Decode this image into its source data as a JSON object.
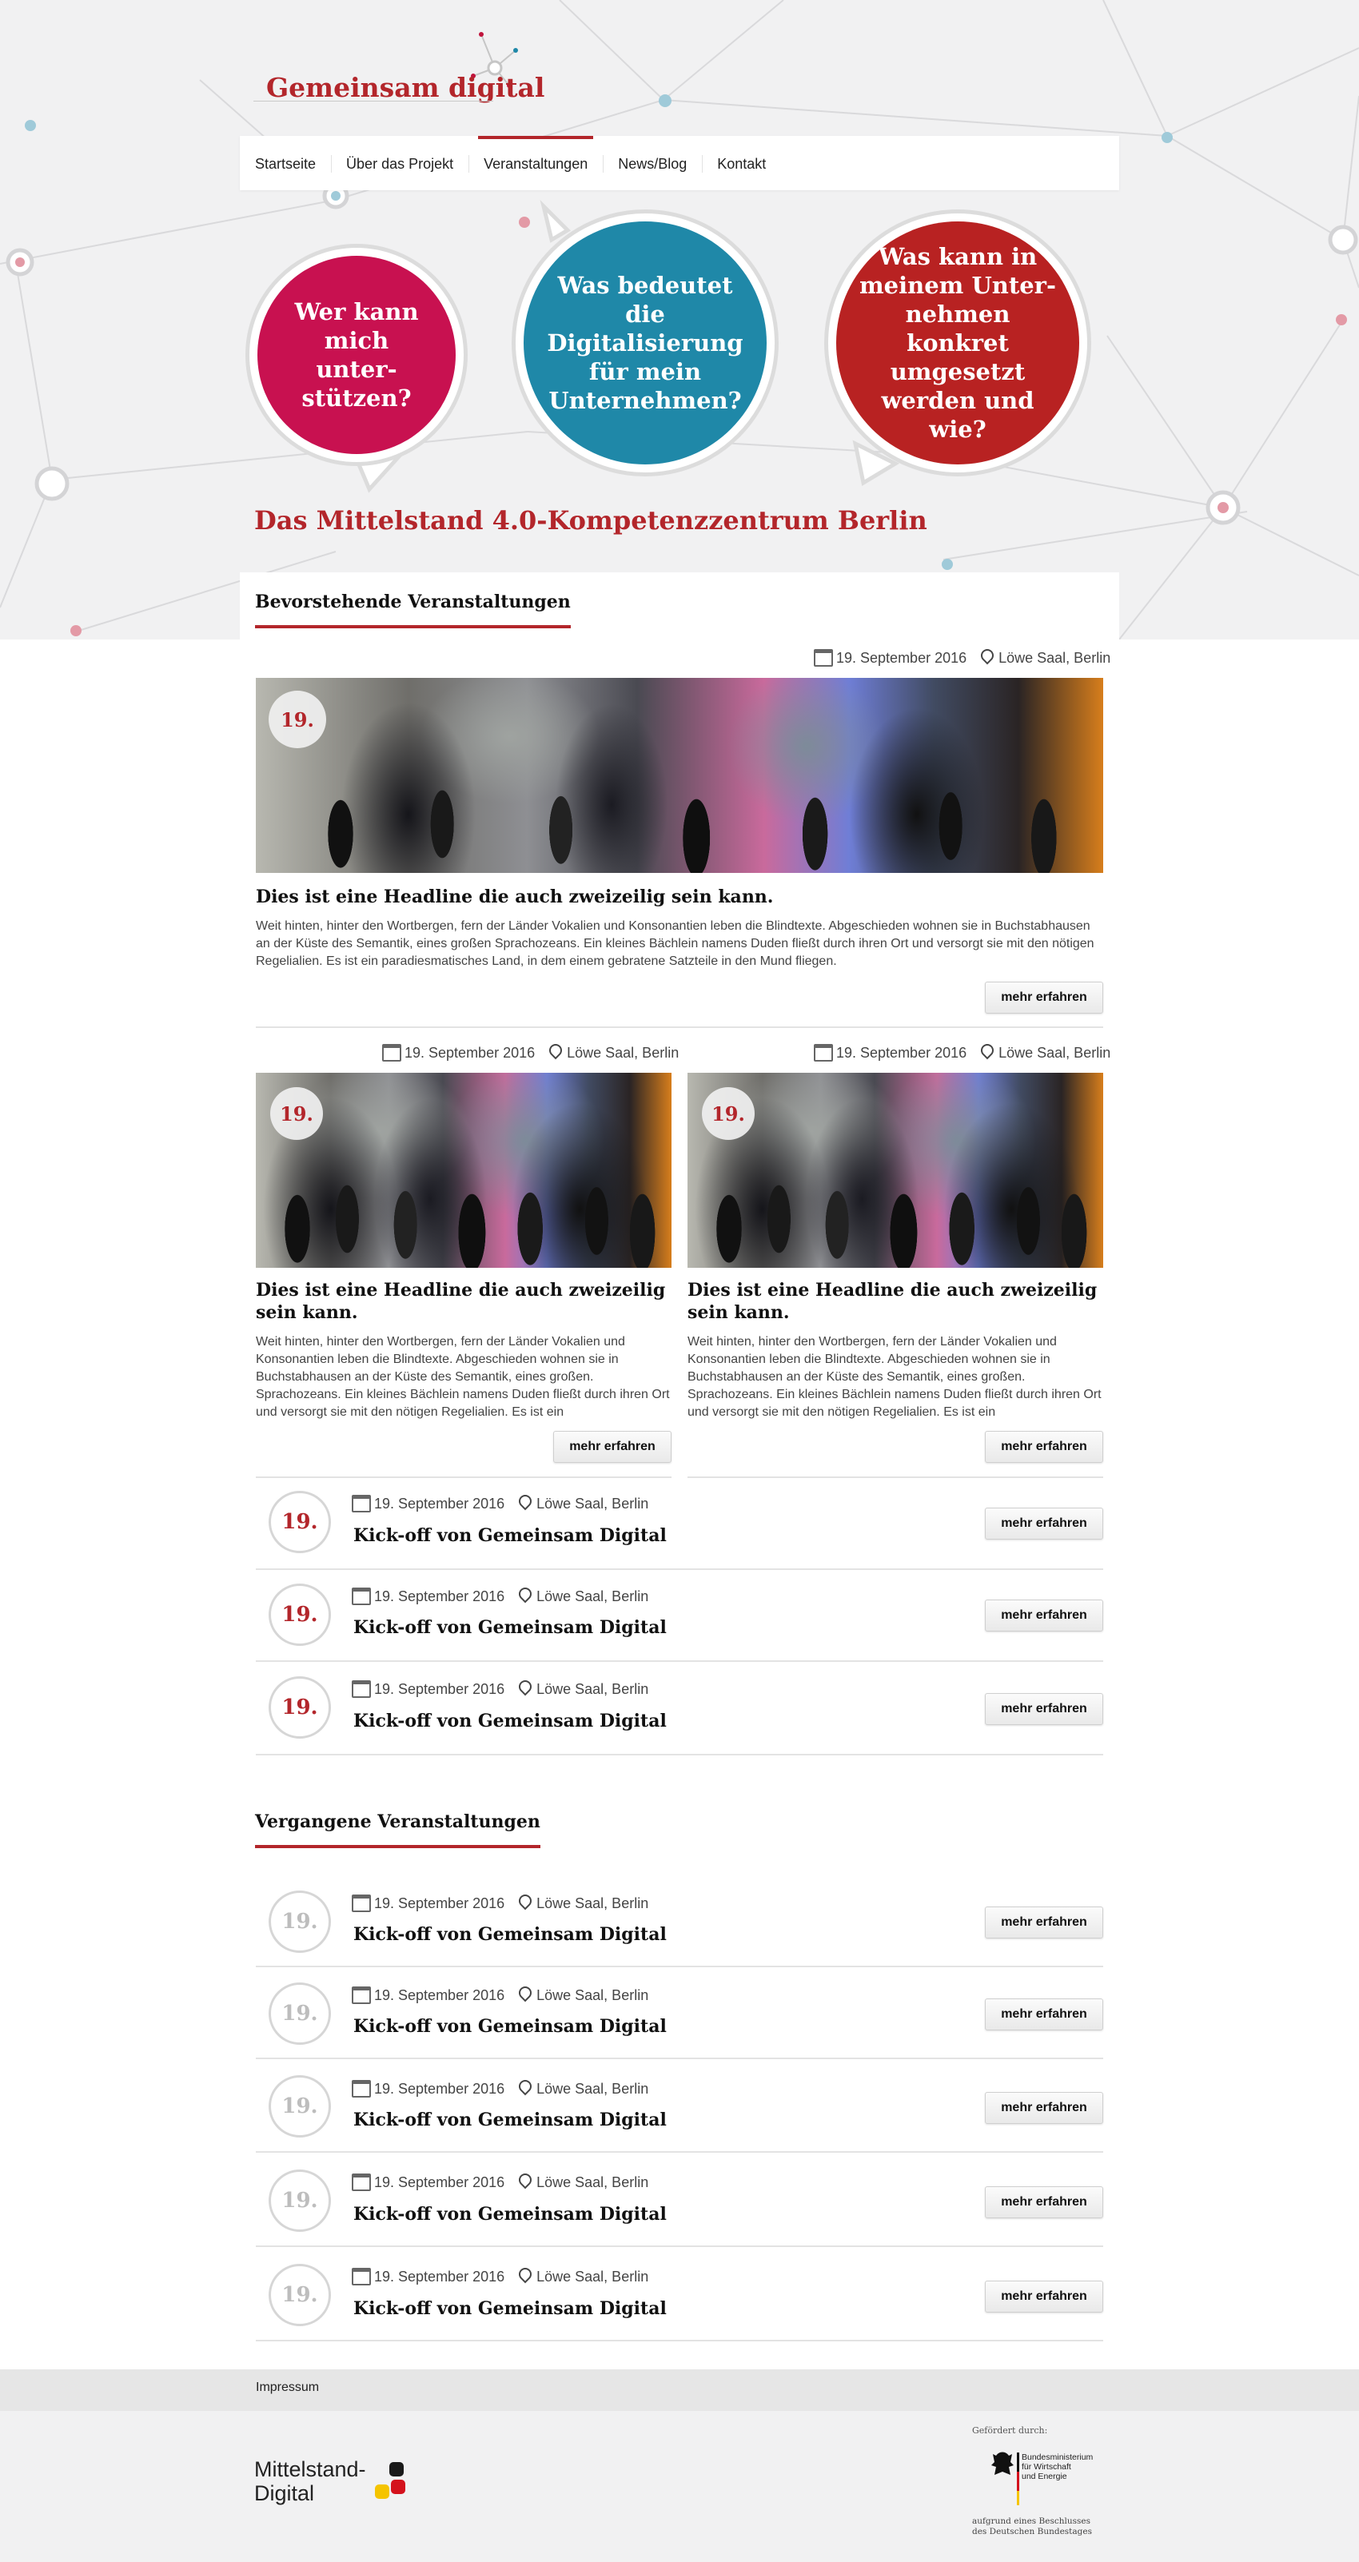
{
  "logo": {
    "text": "Gemeinsam digital"
  },
  "nav": {
    "items": [
      {
        "label": "Startseite"
      },
      {
        "label": "Über das Projekt"
      },
      {
        "label": "Veranstaltungen"
      },
      {
        "label": "News/Blog"
      },
      {
        "label": "Kontakt"
      }
    ],
    "active": "Veranstaltungen"
  },
  "bubbles": [
    {
      "text": "Wer kann mich unter-stützen?",
      "color": "#c81150"
    },
    {
      "text": "Was bedeutet die Digitalisierung für mein Unternehmen?",
      "color": "#1f88a8"
    },
    {
      "text": "Was kann in meinem Unter-nehmen konkret umgesetzt werden und wie?",
      "color": "#b82222"
    }
  ],
  "main_heading": "Das Mittelstand 4.0-Kompetenzzentrum Berlin",
  "upcoming": {
    "title": "Bevorstehende Veranstaltungen",
    "featured": {
      "date": "19. September 2016",
      "location": "Löwe Saal, Berlin",
      "day": "19.",
      "headline": "Dies ist eine Headline die auch zweizeilig sein kann.",
      "text": "Weit hinten, hinter den Wortbergen, fern der Länder Vokalien und Konsonantien leben die Blindtexte. Abgeschieden wohnen sie in Buchstabhausen an der Küste des Semantik, eines großen Sprachozeans. Ein kleines Bächlein namens Duden fließt durch ihren Ort und versorgt sie mit den nötigen Regelialien. Es ist ein paradiesmatisches Land, in dem einem gebratene Satzteile in den Mund fliegen.",
      "button": "mehr erfahren"
    },
    "cards": [
      {
        "date": "19. September 2016",
        "location": "Löwe Saal, Berlin",
        "day": "19.",
        "headline": "Dies ist eine Headline die auch zweizeilig sein kann.",
        "text": "Weit hinten, hinter den Wortbergen, fern der Länder Vokalien und Konsonantien leben die Blindtexte. Abgeschieden wohnen sie in Buchstabhausen an der Küste des Semantik, eines großen. Sprachozeans. Ein kleines Bächlein namens Duden fließt durch ihren Ort und versorgt sie mit den nötigen Regelialien. Es ist ein",
        "button": "mehr erfahren"
      },
      {
        "date": "19. September 2016",
        "location": "Löwe Saal, Berlin",
        "day": "19.",
        "headline": "Dies ist eine Headline die auch zweizeilig sein kann.",
        "text": "Weit hinten, hinter den Wortbergen, fern der Länder Vokalien und Konsonantien leben die Blindtexte. Abgeschieden wohnen sie in Buchstabhausen an der Küste des Semantik, eines großen. Sprachozeans. Ein kleines Bächlein namens Duden fließt durch ihren Ort und versorgt sie mit den nötigen Regelialien. Es ist ein",
        "button": "mehr erfahren"
      }
    ],
    "rows": [
      {
        "day": "19.",
        "date": "19. September 2016",
        "location": "Löwe Saal, Berlin",
        "title": "Kick-off von Gemeinsam Digital",
        "button": "mehr erfahren"
      },
      {
        "day": "19.",
        "date": "19. September 2016",
        "location": "Löwe Saal, Berlin",
        "title": "Kick-off von Gemeinsam Digital",
        "button": "mehr erfahren"
      },
      {
        "day": "19.",
        "date": "19. September 2016",
        "location": "Löwe Saal, Berlin",
        "title": "Kick-off von Gemeinsam Digital",
        "button": "mehr erfahren"
      }
    ]
  },
  "past": {
    "title": "Vergangene Veranstaltungen",
    "rows": [
      {
        "day": "19.",
        "date": "19. September 2016",
        "location": "Löwe Saal, Berlin",
        "title": "Kick-off von Gemeinsam Digital",
        "button": "mehr erfahren"
      },
      {
        "day": "19.",
        "date": "19. September 2016",
        "location": "Löwe Saal, Berlin",
        "title": "Kick-off von Gemeinsam Digital",
        "button": "mehr erfahren"
      },
      {
        "day": "19.",
        "date": "19. September 2016",
        "location": "Löwe Saal, Berlin",
        "title": "Kick-off von Gemeinsam Digital",
        "button": "mehr erfahren"
      },
      {
        "day": "19.",
        "date": "19. September 2016",
        "location": "Löwe Saal, Berlin",
        "title": "Kick-off von Gemeinsam Digital",
        "button": "mehr erfahren"
      },
      {
        "day": "19.",
        "date": "19. September 2016",
        "location": "Löwe Saal, Berlin",
        "title": "Kick-off von Gemeinsam Digital",
        "button": "mehr erfahren"
      }
    ]
  },
  "footer": {
    "impressum": "Impressum",
    "md_logo_line1": "Mittelstand-",
    "md_logo_line2": "Digital",
    "funded_label": "Gefördert durch:",
    "ministry_line1": "Bundesministerium",
    "ministry_line2": "für Wirtschaft",
    "ministry_line3": "und Energie",
    "bundestag_line1": "aufgrund eines Beschlusses",
    "bundestag_line2": "des Deutschen Bundestages"
  },
  "colors": {
    "accent": "#b3262b",
    "magenta": "#c81150",
    "teal": "#1f88a8",
    "red": "#b82222"
  }
}
